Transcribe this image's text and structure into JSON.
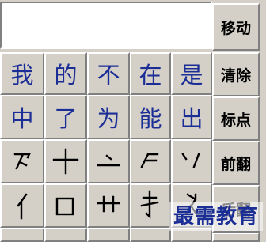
{
  "input": {
    "value": ""
  },
  "side_buttons": {
    "move": "移动",
    "clear": "清除",
    "punct": "标点",
    "prev_page": "前翻",
    "next_page": "后翻"
  },
  "candidates_row1": [
    "我",
    "的",
    "不",
    "在",
    "是"
  ],
  "candidates_row2": [
    "中",
    "了",
    "为",
    "能",
    "出"
  ],
  "strokes": {
    "row3": [
      "stroke-pie-zhe-icon",
      "stroke-heng-shu-icon",
      "stroke-dian-heng-icon",
      "stroke-pie-heng-icon",
      "stroke-dian-pie-icon"
    ],
    "row4": [
      "stroke-radical-person-icon",
      "stroke-radical-mouth-icon",
      "stroke-radical-grass-icon",
      "stroke-radical-hand-icon",
      "stroke-radical-dog-icon"
    ]
  },
  "watermark": "最需教育",
  "colors": {
    "background": "#d4d0c8",
    "candidate_text": "#1b2e96",
    "watermark": "#1b2e96"
  }
}
